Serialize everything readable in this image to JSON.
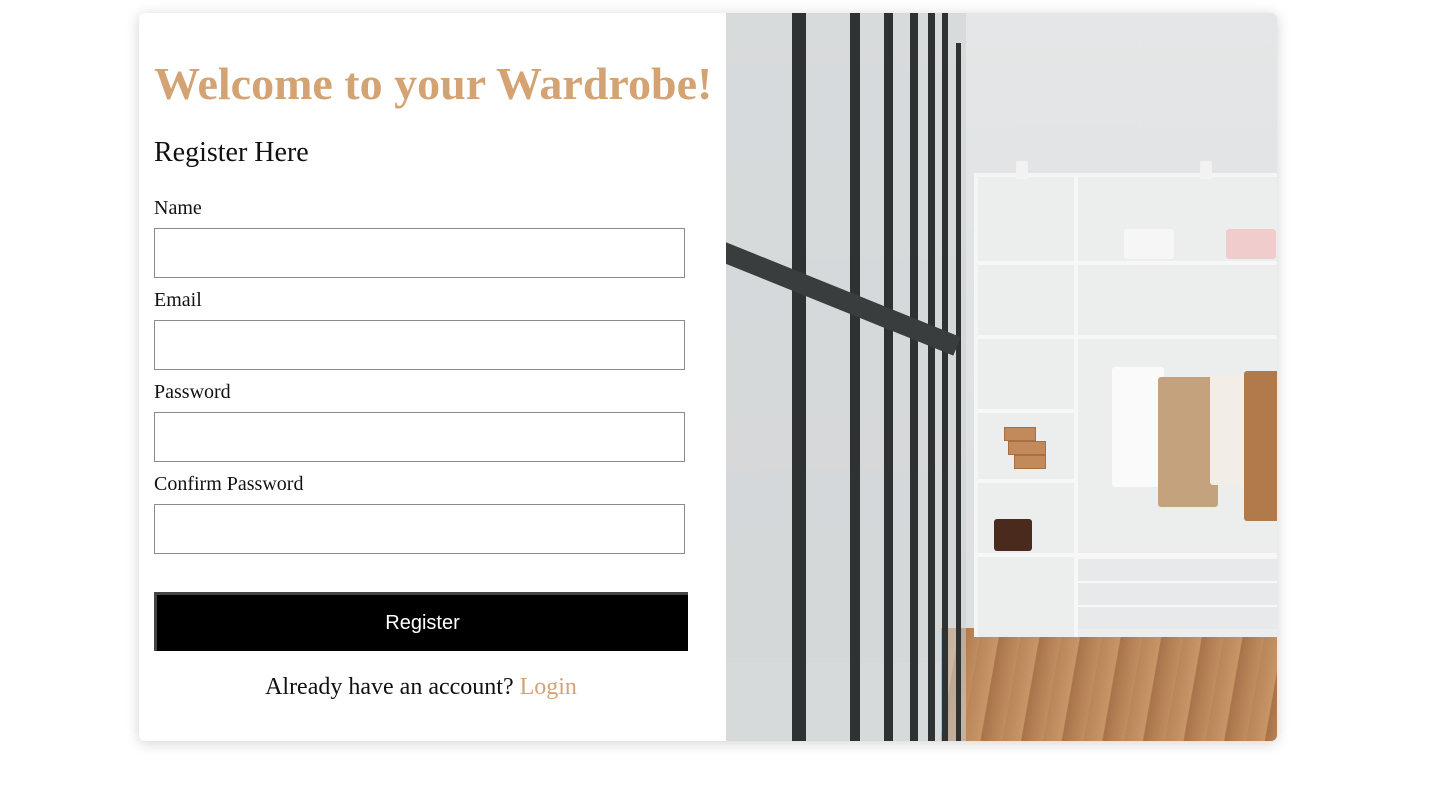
{
  "page": {
    "title": "Welcome to your Wardrobe!",
    "subtitle": "Register Here"
  },
  "form": {
    "fields": [
      {
        "label": "Name",
        "value": ""
      },
      {
        "label": "Email",
        "value": ""
      },
      {
        "label": "Password",
        "value": ""
      },
      {
        "label": "Confirm Password",
        "value": ""
      }
    ],
    "submit_label": "Register",
    "login_prompt": "Already have an account?",
    "login_link": "Login"
  },
  "colors": {
    "accent": "#d4a373",
    "button_bg": "#000000",
    "button_text": "#ffffff"
  },
  "image": {
    "subject": "wardrobe-photo"
  }
}
